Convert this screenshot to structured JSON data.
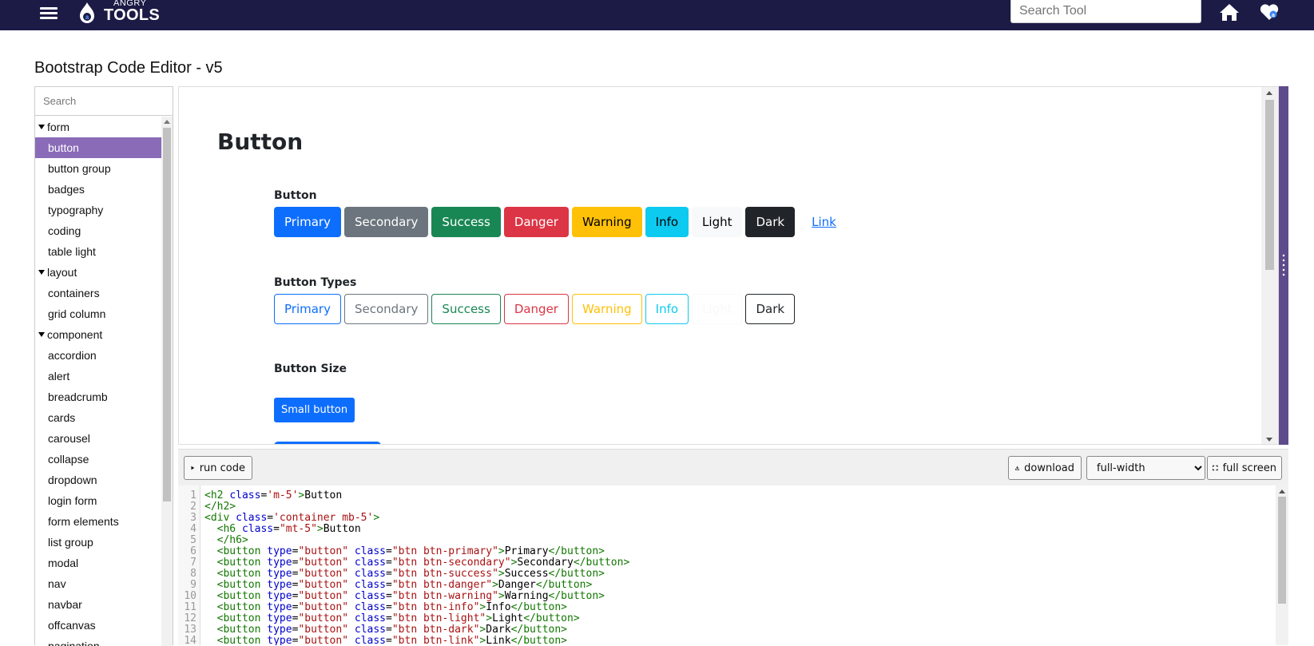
{
  "header": {
    "logo_top": "ANGRY",
    "logo_main": "TOOLS",
    "search_placeholder": "Search Tool"
  },
  "page": {
    "title": "Bootstrap Code Editor - v5"
  },
  "sidebar": {
    "search_placeholder": "Search",
    "items": [
      {
        "label": "form",
        "kind": "group"
      },
      {
        "label": "button",
        "kind": "child",
        "active": true
      },
      {
        "label": "button group",
        "kind": "child"
      },
      {
        "label": "badges",
        "kind": "child"
      },
      {
        "label": "typography",
        "kind": "child"
      },
      {
        "label": "coding",
        "kind": "child"
      },
      {
        "label": "table light",
        "kind": "child"
      },
      {
        "label": "layout",
        "kind": "group"
      },
      {
        "label": "containers",
        "kind": "child"
      },
      {
        "label": "grid column",
        "kind": "child"
      },
      {
        "label": "component",
        "kind": "group"
      },
      {
        "label": "accordion",
        "kind": "child"
      },
      {
        "label": "alert",
        "kind": "child"
      },
      {
        "label": "breadcrumb",
        "kind": "child"
      },
      {
        "label": "cards",
        "kind": "child"
      },
      {
        "label": "carousel",
        "kind": "child"
      },
      {
        "label": "collapse",
        "kind": "child"
      },
      {
        "label": "dropdown",
        "kind": "child"
      },
      {
        "label": "login form",
        "kind": "child"
      },
      {
        "label": "form elements",
        "kind": "child"
      },
      {
        "label": "list group",
        "kind": "child"
      },
      {
        "label": "modal",
        "kind": "child"
      },
      {
        "label": "nav",
        "kind": "child"
      },
      {
        "label": "navbar",
        "kind": "child"
      },
      {
        "label": "offcanvas",
        "kind": "child"
      },
      {
        "label": "pagination",
        "kind": "child"
      }
    ]
  },
  "preview": {
    "heading": "Button",
    "sections": [
      {
        "title": "Button",
        "buttons": [
          {
            "label": "Primary",
            "style": "primary"
          },
          {
            "label": "Secondary",
            "style": "secondary"
          },
          {
            "label": "Success",
            "style": "success"
          },
          {
            "label": "Danger",
            "style": "danger"
          },
          {
            "label": "Warning",
            "style": "warning"
          },
          {
            "label": "Info",
            "style": "info"
          },
          {
            "label": "Light",
            "style": "light"
          },
          {
            "label": "Dark",
            "style": "dark"
          },
          {
            "label": "Link",
            "style": "link"
          }
        ]
      },
      {
        "title": "Button Types",
        "buttons": [
          {
            "label": "Primary",
            "style": "outline-primary"
          },
          {
            "label": "Secondary",
            "style": "outline-secondary"
          },
          {
            "label": "Success",
            "style": "outline-success"
          },
          {
            "label": "Danger",
            "style": "outline-danger"
          },
          {
            "label": "Warning",
            "style": "outline-warning"
          },
          {
            "label": "Info",
            "style": "outline-info"
          },
          {
            "label": "Light",
            "style": "outline-light"
          },
          {
            "label": "Dark",
            "style": "outline-dark"
          }
        ]
      },
      {
        "title": "Button Size",
        "buttons": [
          {
            "label": "Small button",
            "style": "primary-sm"
          }
        ]
      }
    ]
  },
  "toolbar": {
    "run_label": "run code",
    "download_label": "download",
    "width_selected": "full-width",
    "fullscreen_label": "full screen"
  },
  "editor": {
    "lines": [
      [
        [
          "tag",
          "<h2 "
        ],
        [
          "attr",
          "class"
        ],
        [
          "plain",
          "="
        ],
        [
          "str",
          "'m-5'"
        ],
        [
          "tag",
          ">"
        ],
        [
          "plain",
          "Button"
        ]
      ],
      [
        [
          "tag",
          "</h2>"
        ]
      ],
      [
        [
          "tag",
          "<div "
        ],
        [
          "attr",
          "class"
        ],
        [
          "plain",
          "="
        ],
        [
          "str",
          "'container mb-5'"
        ],
        [
          "tag",
          ">"
        ]
      ],
      [
        [
          "plain",
          "  "
        ],
        [
          "tag",
          "<h6 "
        ],
        [
          "attr",
          "class"
        ],
        [
          "plain",
          "="
        ],
        [
          "str",
          "\"mt-5\""
        ],
        [
          "tag",
          ">"
        ],
        [
          "plain",
          "Button"
        ]
      ],
      [
        [
          "plain",
          "  "
        ],
        [
          "tag",
          "</h6>"
        ]
      ],
      [
        [
          "plain",
          "  "
        ],
        [
          "tag",
          "<button "
        ],
        [
          "attr",
          "type"
        ],
        [
          "plain",
          "="
        ],
        [
          "str",
          "\"button\""
        ],
        [
          "plain",
          " "
        ],
        [
          "attr",
          "class"
        ],
        [
          "plain",
          "="
        ],
        [
          "str",
          "\"btn btn-primary\""
        ],
        [
          "tag",
          ">"
        ],
        [
          "plain",
          "Primary"
        ],
        [
          "tag",
          "</button>"
        ]
      ],
      [
        [
          "plain",
          "  "
        ],
        [
          "tag",
          "<button "
        ],
        [
          "attr",
          "type"
        ],
        [
          "plain",
          "="
        ],
        [
          "str",
          "\"button\""
        ],
        [
          "plain",
          " "
        ],
        [
          "attr",
          "class"
        ],
        [
          "plain",
          "="
        ],
        [
          "str",
          "\"btn btn-secondary\""
        ],
        [
          "tag",
          ">"
        ],
        [
          "plain",
          "Secondary"
        ],
        [
          "tag",
          "</button>"
        ]
      ],
      [
        [
          "plain",
          "  "
        ],
        [
          "tag",
          "<button "
        ],
        [
          "attr",
          "type"
        ],
        [
          "plain",
          "="
        ],
        [
          "str",
          "\"button\""
        ],
        [
          "plain",
          " "
        ],
        [
          "attr",
          "class"
        ],
        [
          "plain",
          "="
        ],
        [
          "str",
          "\"btn btn-success\""
        ],
        [
          "tag",
          ">"
        ],
        [
          "plain",
          "Success"
        ],
        [
          "tag",
          "</button>"
        ]
      ],
      [
        [
          "plain",
          "  "
        ],
        [
          "tag",
          "<button "
        ],
        [
          "attr",
          "type"
        ],
        [
          "plain",
          "="
        ],
        [
          "str",
          "\"button\""
        ],
        [
          "plain",
          " "
        ],
        [
          "attr",
          "class"
        ],
        [
          "plain",
          "="
        ],
        [
          "str",
          "\"btn btn-danger\""
        ],
        [
          "tag",
          ">"
        ],
        [
          "plain",
          "Danger"
        ],
        [
          "tag",
          "</button>"
        ]
      ],
      [
        [
          "plain",
          "  "
        ],
        [
          "tag",
          "<button "
        ],
        [
          "attr",
          "type"
        ],
        [
          "plain",
          "="
        ],
        [
          "str",
          "\"button\""
        ],
        [
          "plain",
          " "
        ],
        [
          "attr",
          "class"
        ],
        [
          "plain",
          "="
        ],
        [
          "str",
          "\"btn btn-warning\""
        ],
        [
          "tag",
          ">"
        ],
        [
          "plain",
          "Warning"
        ],
        [
          "tag",
          "</button>"
        ]
      ],
      [
        [
          "plain",
          "  "
        ],
        [
          "tag",
          "<button "
        ],
        [
          "attr",
          "type"
        ],
        [
          "plain",
          "="
        ],
        [
          "str",
          "\"button\""
        ],
        [
          "plain",
          " "
        ],
        [
          "attr",
          "class"
        ],
        [
          "plain",
          "="
        ],
        [
          "str",
          "\"btn btn-info\""
        ],
        [
          "tag",
          ">"
        ],
        [
          "plain",
          "Info"
        ],
        [
          "tag",
          "</button>"
        ]
      ],
      [
        [
          "plain",
          "  "
        ],
        [
          "tag",
          "<button "
        ],
        [
          "attr",
          "type"
        ],
        [
          "plain",
          "="
        ],
        [
          "str",
          "\"button\""
        ],
        [
          "plain",
          " "
        ],
        [
          "attr",
          "class"
        ],
        [
          "plain",
          "="
        ],
        [
          "str",
          "\"btn btn-light\""
        ],
        [
          "tag",
          ">"
        ],
        [
          "plain",
          "Light"
        ],
        [
          "tag",
          "</button>"
        ]
      ],
      [
        [
          "plain",
          "  "
        ],
        [
          "tag",
          "<button "
        ],
        [
          "attr",
          "type"
        ],
        [
          "plain",
          "="
        ],
        [
          "str",
          "\"button\""
        ],
        [
          "plain",
          " "
        ],
        [
          "attr",
          "class"
        ],
        [
          "plain",
          "="
        ],
        [
          "str",
          "\"btn btn-dark\""
        ],
        [
          "tag",
          ">"
        ],
        [
          "plain",
          "Dark"
        ],
        [
          "tag",
          "</button>"
        ]
      ],
      [
        [
          "plain",
          "  "
        ],
        [
          "tag",
          "<button "
        ],
        [
          "attr",
          "type"
        ],
        [
          "plain",
          "="
        ],
        [
          "str",
          "\"button\""
        ],
        [
          "plain",
          " "
        ],
        [
          "attr",
          "class"
        ],
        [
          "plain",
          "="
        ],
        [
          "str",
          "\"btn btn-link\""
        ],
        [
          "tag",
          ">"
        ],
        [
          "plain",
          "Link"
        ],
        [
          "tag",
          "</button>"
        ]
      ]
    ]
  },
  "colors": {
    "header_bg": "#1c1b46",
    "sidebar_active": "#8a6bb8",
    "resize_bar": "#5e4b8b"
  }
}
